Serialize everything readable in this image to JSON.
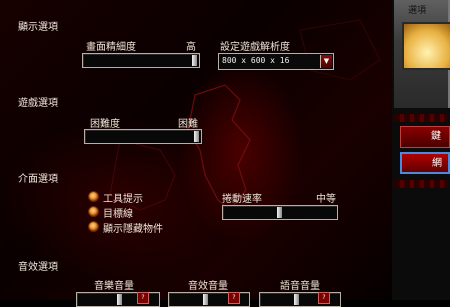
{
  "display": {
    "title": "顯示選項",
    "detail_label": "畫面精細度",
    "detail_level": "高",
    "resolution_label": "設定遊戲解析度",
    "resolution_value": "800 x 600 x 16"
  },
  "gameplay": {
    "title": "遊戲選項",
    "difficulty_label": "困難度",
    "difficulty_value": "困難"
  },
  "interface": {
    "title": "介面選項",
    "options": [
      "工具提示",
      "目標線",
      "顯示隱藏物件"
    ],
    "scroll_label": "捲動速率",
    "scroll_value": "中等"
  },
  "sound": {
    "title": "音效選項",
    "music_label": "音樂音量",
    "sfx_label": "音效音量",
    "voice_label": "語音音量"
  },
  "sidebar": {
    "header": "選項",
    "btn1": "鍵",
    "btn2": "網"
  },
  "colors": {
    "accent_red": "#8a0000",
    "selected_border": "#4a8adf",
    "checkbox_orange": "#f0a040"
  }
}
